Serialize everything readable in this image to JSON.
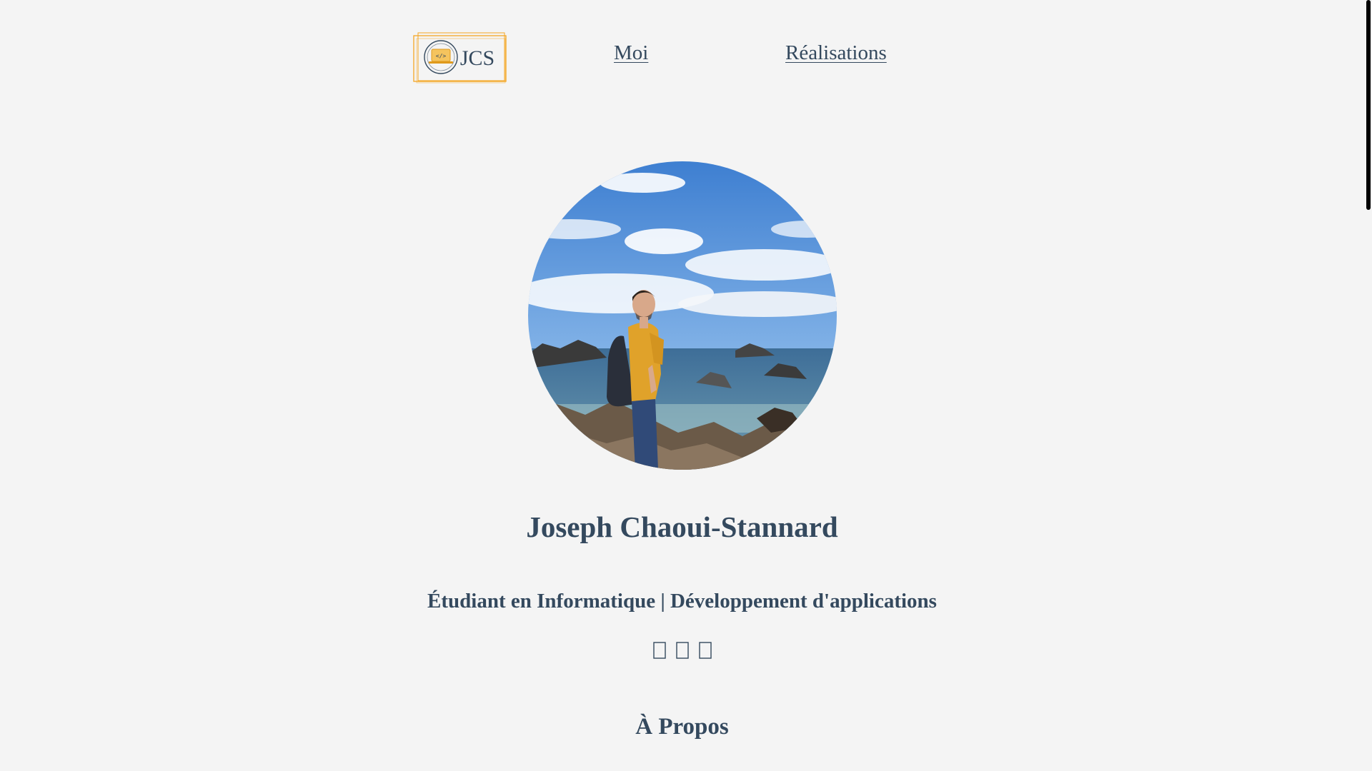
{
  "nav": {
    "logo_text": "JCS",
    "links": [
      {
        "label": "Moi"
      },
      {
        "label": "Réalisations"
      }
    ]
  },
  "profile": {
    "name": "Joseph Chaoui-Stannard",
    "tagline": "Étudiant en Informatique | Développement d'applications",
    "socials": [
      {
        "icon": "github-icon"
      },
      {
        "icon": "linkedin-icon"
      },
      {
        "icon": "email-icon"
      }
    ]
  },
  "about": {
    "title": "À Propos"
  },
  "colors": {
    "text": "#34495e",
    "background": "#f4f4f4",
    "logo_accent": "#f5a623"
  }
}
